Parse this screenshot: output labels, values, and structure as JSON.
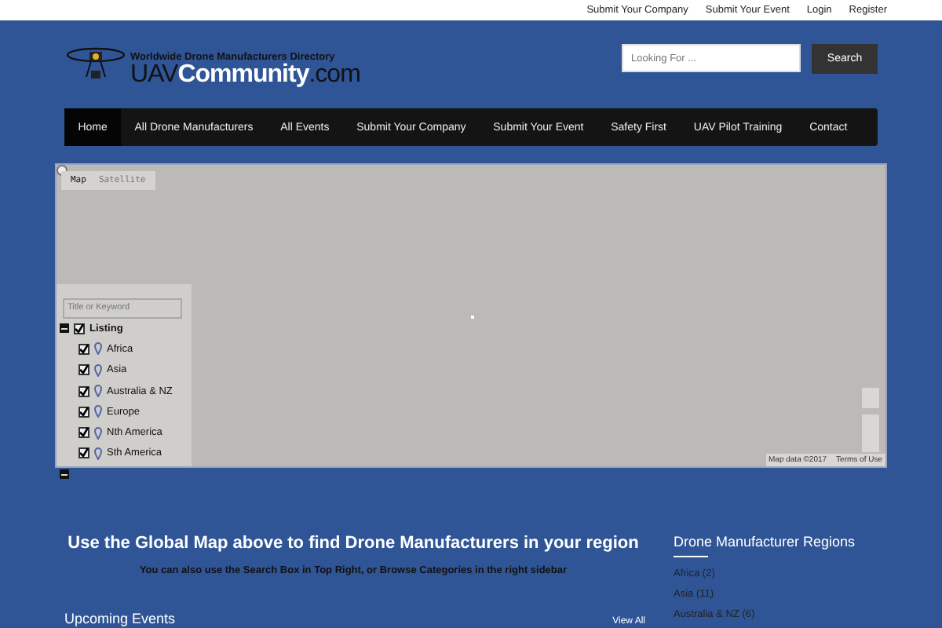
{
  "top_links": [
    "Submit Your Company",
    "Submit Your Event",
    "Login",
    "Register"
  ],
  "logo": {
    "tagline": "Worldwide Drone Manufacturers Directory",
    "name": "UAV**Community**.com"
  },
  "search": {
    "placeholder": "Looking For ...",
    "button": "Search"
  },
  "nav": [
    {
      "label": "Home",
      "selected": true
    },
    {
      "label": "All Drone Manufacturers",
      "selected": false
    },
    {
      "label": "All Events",
      "selected": false
    },
    {
      "label": "Submit Your Company",
      "selected": false
    },
    {
      "label": "Submit Your Event",
      "selected": false
    },
    {
      "label": "Safety First",
      "selected": false
    },
    {
      "label": "UAV Pilot Training",
      "selected": false
    },
    {
      "label": "Contact",
      "selected": false
    }
  ],
  "map": {
    "type_buttons": [
      {
        "label": "Map",
        "selected": true
      },
      {
        "label": "Satellite",
        "selected": false
      }
    ],
    "filter_placeholder": "Title or Keyword",
    "listing": {
      "label": "Listing",
      "expanded": true,
      "checked": true,
      "children": [
        {
          "label": "Africa",
          "checked": true
        },
        {
          "label": "Asia",
          "checked": true
        },
        {
          "label": "Australia & NZ",
          "checked": true
        },
        {
          "label": "Europe",
          "checked": true
        },
        {
          "label": "Nth America",
          "checked": true
        },
        {
          "label": "Sth America",
          "checked": true
        }
      ]
    },
    "attribution": "Map data ©2017",
    "terms": "Terms of Use"
  },
  "main": {
    "heading": "Use the Global Map above to find Drone Manufacturers in your region",
    "subtext": "You can also use the Search Box in Top Right, or Browse Categories in the right sidebar"
  },
  "sidebar": {
    "title": "Drone Manufacturer Regions",
    "regions": [
      "Africa (2)",
      "Asia (11)",
      "Australia & NZ (6)"
    ]
  },
  "events": {
    "title": "Upcoming Events",
    "view_all": "View All"
  }
}
